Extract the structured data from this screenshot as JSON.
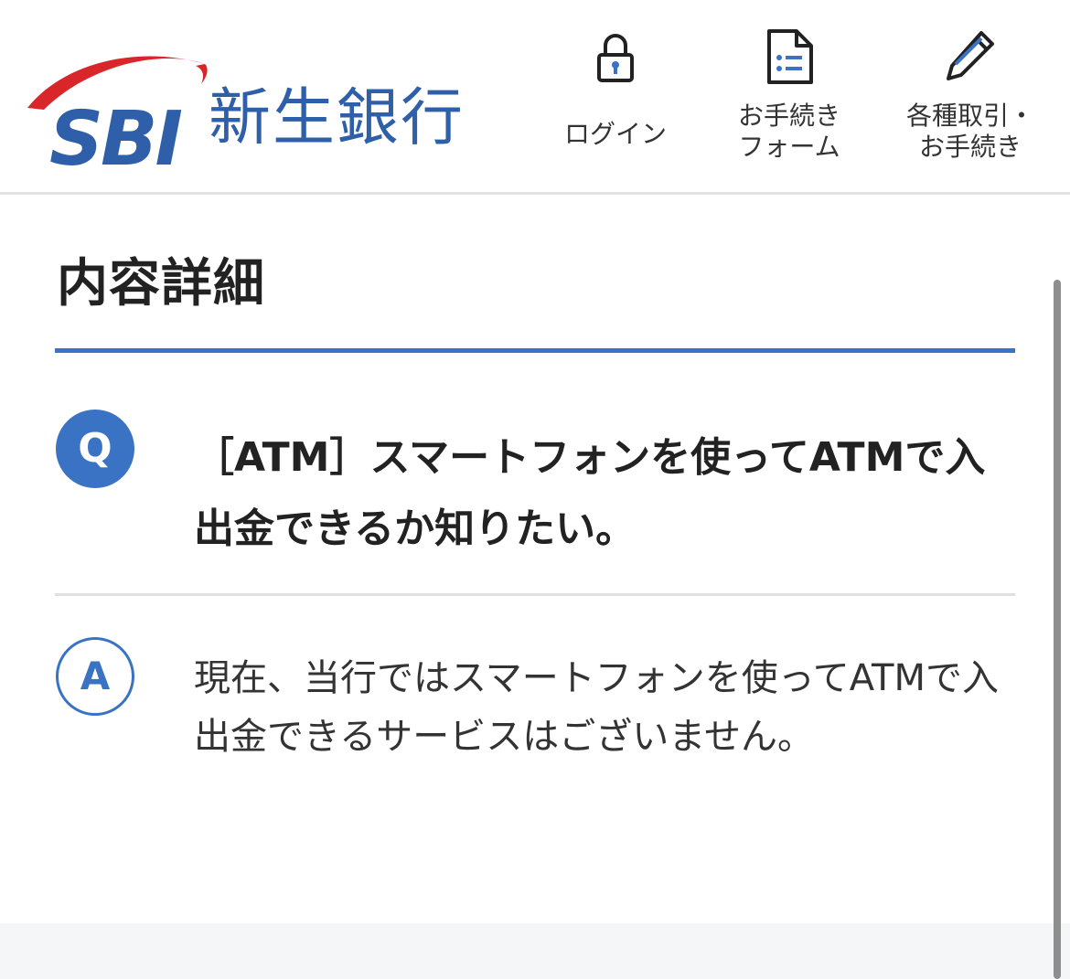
{
  "header": {
    "logo_brand": "SBI",
    "logo_name": "新生銀行",
    "nav": [
      {
        "label": "ログイン",
        "icon": "lock-icon"
      },
      {
        "label": "お手続き\nフォーム",
        "icon": "form-document-icon"
      },
      {
        "label": "各種取引・\nお手続き",
        "icon": "pencil-icon"
      }
    ]
  },
  "content": {
    "title": "内容詳細",
    "question_badge": "Q",
    "question": "［ATM］スマートフォンを使ってATMで入出金できるか知りたい。",
    "answer_badge": "A",
    "answer": "現在、当行ではスマートフォンを使ってATMで入出金できるサービスはございません。"
  },
  "colors": {
    "brand_blue": "#2e5fa8",
    "accent_blue": "#3b73c4",
    "logo_swoosh_red": "#d9262b"
  }
}
